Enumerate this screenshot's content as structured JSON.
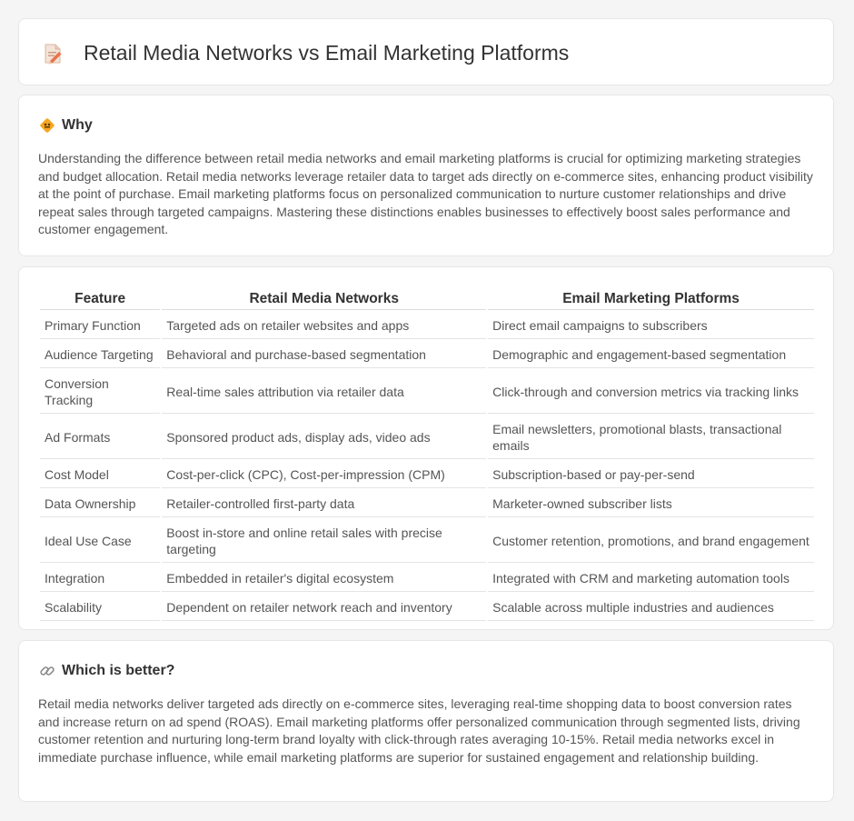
{
  "header": {
    "title": "Retail Media Networks vs Email Marketing Platforms",
    "icon": "document-pencil-icon"
  },
  "why": {
    "icon": "road-sign-icon",
    "title": "Why",
    "text": "Understanding the difference between retail media networks and email marketing platforms is crucial for optimizing marketing strategies and budget allocation. Retail media networks leverage retailer data to target ads directly on e-commerce sites, enhancing product visibility at the point of purchase. Email marketing platforms focus on personalized communication to nurture customer relationships and drive repeat sales through targeted campaigns. Mastering these distinctions enables businesses to effectively boost sales performance and customer engagement."
  },
  "table": {
    "headers": [
      "Feature",
      "Retail Media Networks",
      "Email Marketing Platforms"
    ],
    "rows": [
      [
        "Primary Function",
        "Targeted ads on retailer websites and apps",
        "Direct email campaigns to subscribers"
      ],
      [
        "Audience Targeting",
        "Behavioral and purchase-based segmentation",
        "Demographic and engagement-based segmentation"
      ],
      [
        "Conversion Tracking",
        "Real-time sales attribution via retailer data",
        "Click-through and conversion metrics via tracking links"
      ],
      [
        "Ad Formats",
        "Sponsored product ads, display ads, video ads",
        "Email newsletters, promotional blasts, transactional emails"
      ],
      [
        "Cost Model",
        "Cost-per-click (CPC), Cost-per-impression (CPM)",
        "Subscription-based or pay-per-send"
      ],
      [
        "Data Ownership",
        "Retailer-controlled first-party data",
        "Marketer-owned subscriber lists"
      ],
      [
        "Ideal Use Case",
        "Boost in-store and online retail sales with precise targeting",
        "Customer retention, promotions, and brand engagement"
      ],
      [
        "Integration",
        "Embedded in retailer's digital ecosystem",
        "Integrated with CRM and marketing automation tools"
      ],
      [
        "Scalability",
        "Dependent on retailer network reach and inventory",
        "Scalable across multiple industries and audiences"
      ]
    ]
  },
  "better": {
    "icon": "link-icon",
    "title": "Which is better?",
    "text": "Retail media networks deliver targeted ads directly on e-commerce sites, leveraging real-time shopping data to boost conversion rates and increase return on ad spend (ROAS). Email marketing platforms offer personalized communication through segmented lists, driving customer retention and nurturing long-term brand loyalty with click-through rates averaging 10-15%. Retail media networks excel in immediate purchase influence, while email marketing platforms are superior for sustained engagement and relationship building."
  }
}
